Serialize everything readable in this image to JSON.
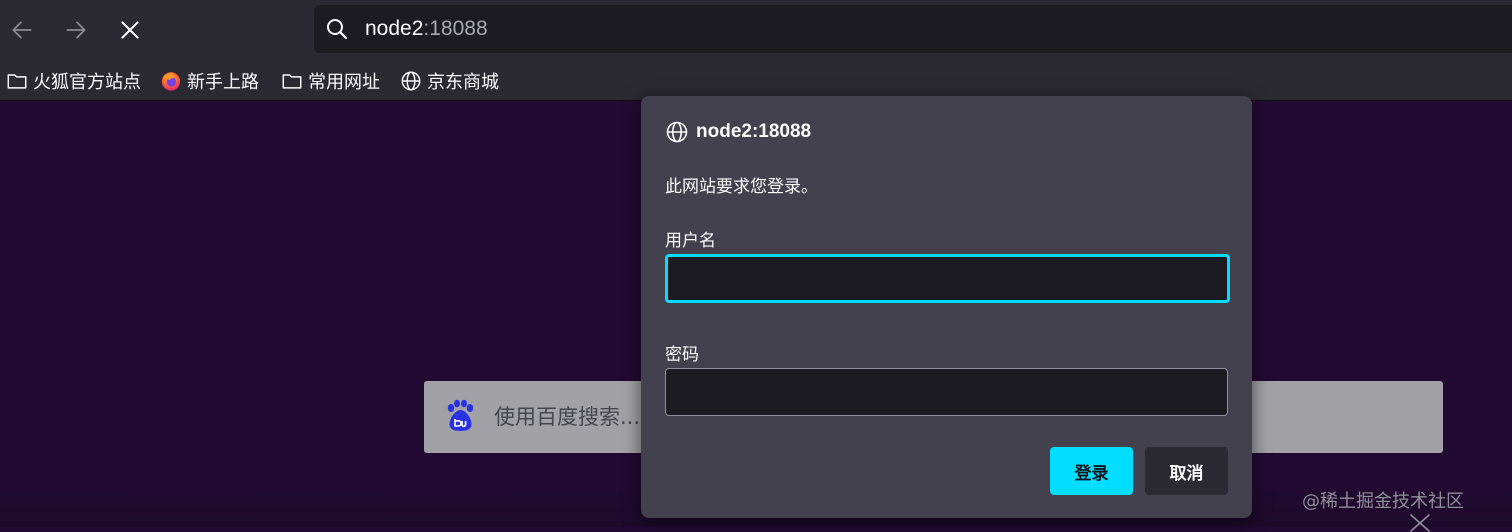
{
  "toolbar": {
    "url_host": "node2",
    "url_port": ":18088",
    "icons": {
      "back": "arrow-left-icon",
      "forward": "arrow-right-icon",
      "stop": "close-icon",
      "search": "search-icon"
    }
  },
  "bookmarks": [
    {
      "label": "火狐官方站点",
      "icon": "folder-icon"
    },
    {
      "label": "新手上路",
      "icon": "firefox-icon"
    },
    {
      "label": "常用网址",
      "icon": "folder-icon"
    },
    {
      "label": "京东商城",
      "icon": "globe-icon"
    }
  ],
  "page": {
    "search_placeholder": "使用百度搜索...",
    "search_logo": "baidu-paw-icon",
    "watermark": "@稀土掘金技术社区"
  },
  "dialog": {
    "host": "node2:18088",
    "message": "此网站要求您登录。",
    "username_label": "用户名",
    "username_value": "",
    "password_label": "密码",
    "password_value": "",
    "login_button": "登录",
    "cancel_button": "取消"
  },
  "colors": {
    "accent": "#00ddff",
    "page_bg": "#230a33",
    "chrome_bg": "#2b2a33",
    "dialog_bg": "#42414d",
    "field_bg": "#1c1b22"
  }
}
